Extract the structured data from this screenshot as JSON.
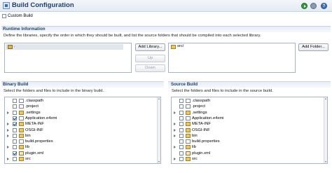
{
  "header": {
    "title": "Build Configuration"
  },
  "custom_build": {
    "label": "Custom Build",
    "checked": false
  },
  "runtime": {
    "title": "Runtime Information",
    "description": "Define the libraries, specify the order in which they should be built, and list the source folders that should be compiled into each selected library.",
    "libraries": [
      "."
    ],
    "source_folders": [
      "src/"
    ],
    "buttons": {
      "add_library": "Add Library...",
      "up": "Up",
      "down": "Down",
      "add_folder": "Add Folder..."
    }
  },
  "binary_build": {
    "title": "Binary Build",
    "description": "Select the folders and files to include in the binary build.",
    "items": [
      {
        "label": ".classpath",
        "type": "file",
        "checked": false,
        "expandable": false
      },
      {
        "label": ".project",
        "type": "file",
        "checked": false,
        "expandable": false
      },
      {
        "label": ".settings",
        "type": "folder",
        "checked": false,
        "expandable": true
      },
      {
        "label": "Application.e4xmi",
        "type": "file",
        "checked": true,
        "expandable": false
      },
      {
        "label": "META-INF",
        "type": "folder",
        "checked": true,
        "expandable": true
      },
      {
        "label": "OSGI-INF",
        "type": "folder",
        "checked": false,
        "expandable": true
      },
      {
        "label": "bin",
        "type": "folder",
        "checked": false,
        "expandable": true
      },
      {
        "label": "build.properties",
        "type": "file",
        "checked": false,
        "expandable": false
      },
      {
        "label": "lib",
        "type": "folder",
        "checked": false,
        "expandable": true
      },
      {
        "label": "plugin.xml",
        "type": "xml",
        "checked": true,
        "expandable": false
      },
      {
        "label": "src",
        "type": "folder",
        "checked": false,
        "expandable": true
      }
    ]
  },
  "source_build": {
    "title": "Source Build",
    "description": "Select the folders and files to include in the source build.",
    "items": [
      {
        "label": ".classpath",
        "type": "file",
        "checked": false,
        "expandable": false
      },
      {
        "label": ".project",
        "type": "file",
        "checked": false,
        "expandable": false
      },
      {
        "label": ".settings",
        "type": "folder",
        "checked": false,
        "expandable": true
      },
      {
        "label": "Application.e4xmi",
        "type": "file",
        "checked": false,
        "expandable": false
      },
      {
        "label": "META-INF",
        "type": "folder",
        "checked": false,
        "expandable": true
      },
      {
        "label": "OSGI-INF",
        "type": "folder",
        "checked": false,
        "expandable": true
      },
      {
        "label": "bin",
        "type": "folder",
        "checked": false,
        "expandable": true
      },
      {
        "label": "build.properties",
        "type": "file",
        "checked": false,
        "expandable": false
      },
      {
        "label": "lib",
        "type": "folder",
        "checked": false,
        "expandable": true
      },
      {
        "label": "plugin.xml",
        "type": "xml",
        "checked": false,
        "expandable": false
      },
      {
        "label": "src",
        "type": "folder",
        "checked": false,
        "expandable": true
      }
    ]
  },
  "icons": {
    "header": "build-config-icon",
    "run": "run-icon",
    "settings": "gear-icon",
    "help": "help-icon"
  }
}
